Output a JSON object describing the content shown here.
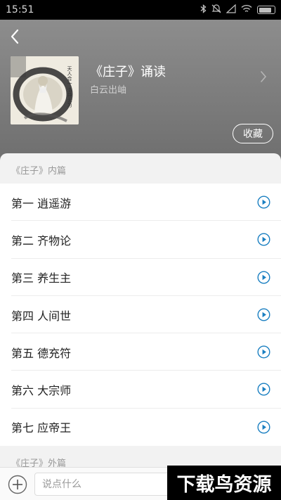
{
  "status_bar": {
    "time": "15:51"
  },
  "album": {
    "title": "《庄子》诵读",
    "author": "白云出岫",
    "favorite_label": "收藏",
    "cover_text": "天人合一 清静无为"
  },
  "sections": [
    {
      "label": "《庄子》内篇",
      "chapters": [
        {
          "title": "第一 逍遥游"
        },
        {
          "title": "第二 齐物论"
        },
        {
          "title": "第三 养生主"
        },
        {
          "title": "第四 人间世"
        },
        {
          "title": "第五 德充符"
        },
        {
          "title": "第六 大宗师"
        },
        {
          "title": "第七 应帝王"
        }
      ]
    },
    {
      "label": "《庄子》外篇"
    }
  ],
  "comment": {
    "placeholder": "说点什么"
  },
  "watermark": "下载鸟资源",
  "colors": {
    "accent": "#1a7fc1",
    "header": "#7e7e7e"
  }
}
